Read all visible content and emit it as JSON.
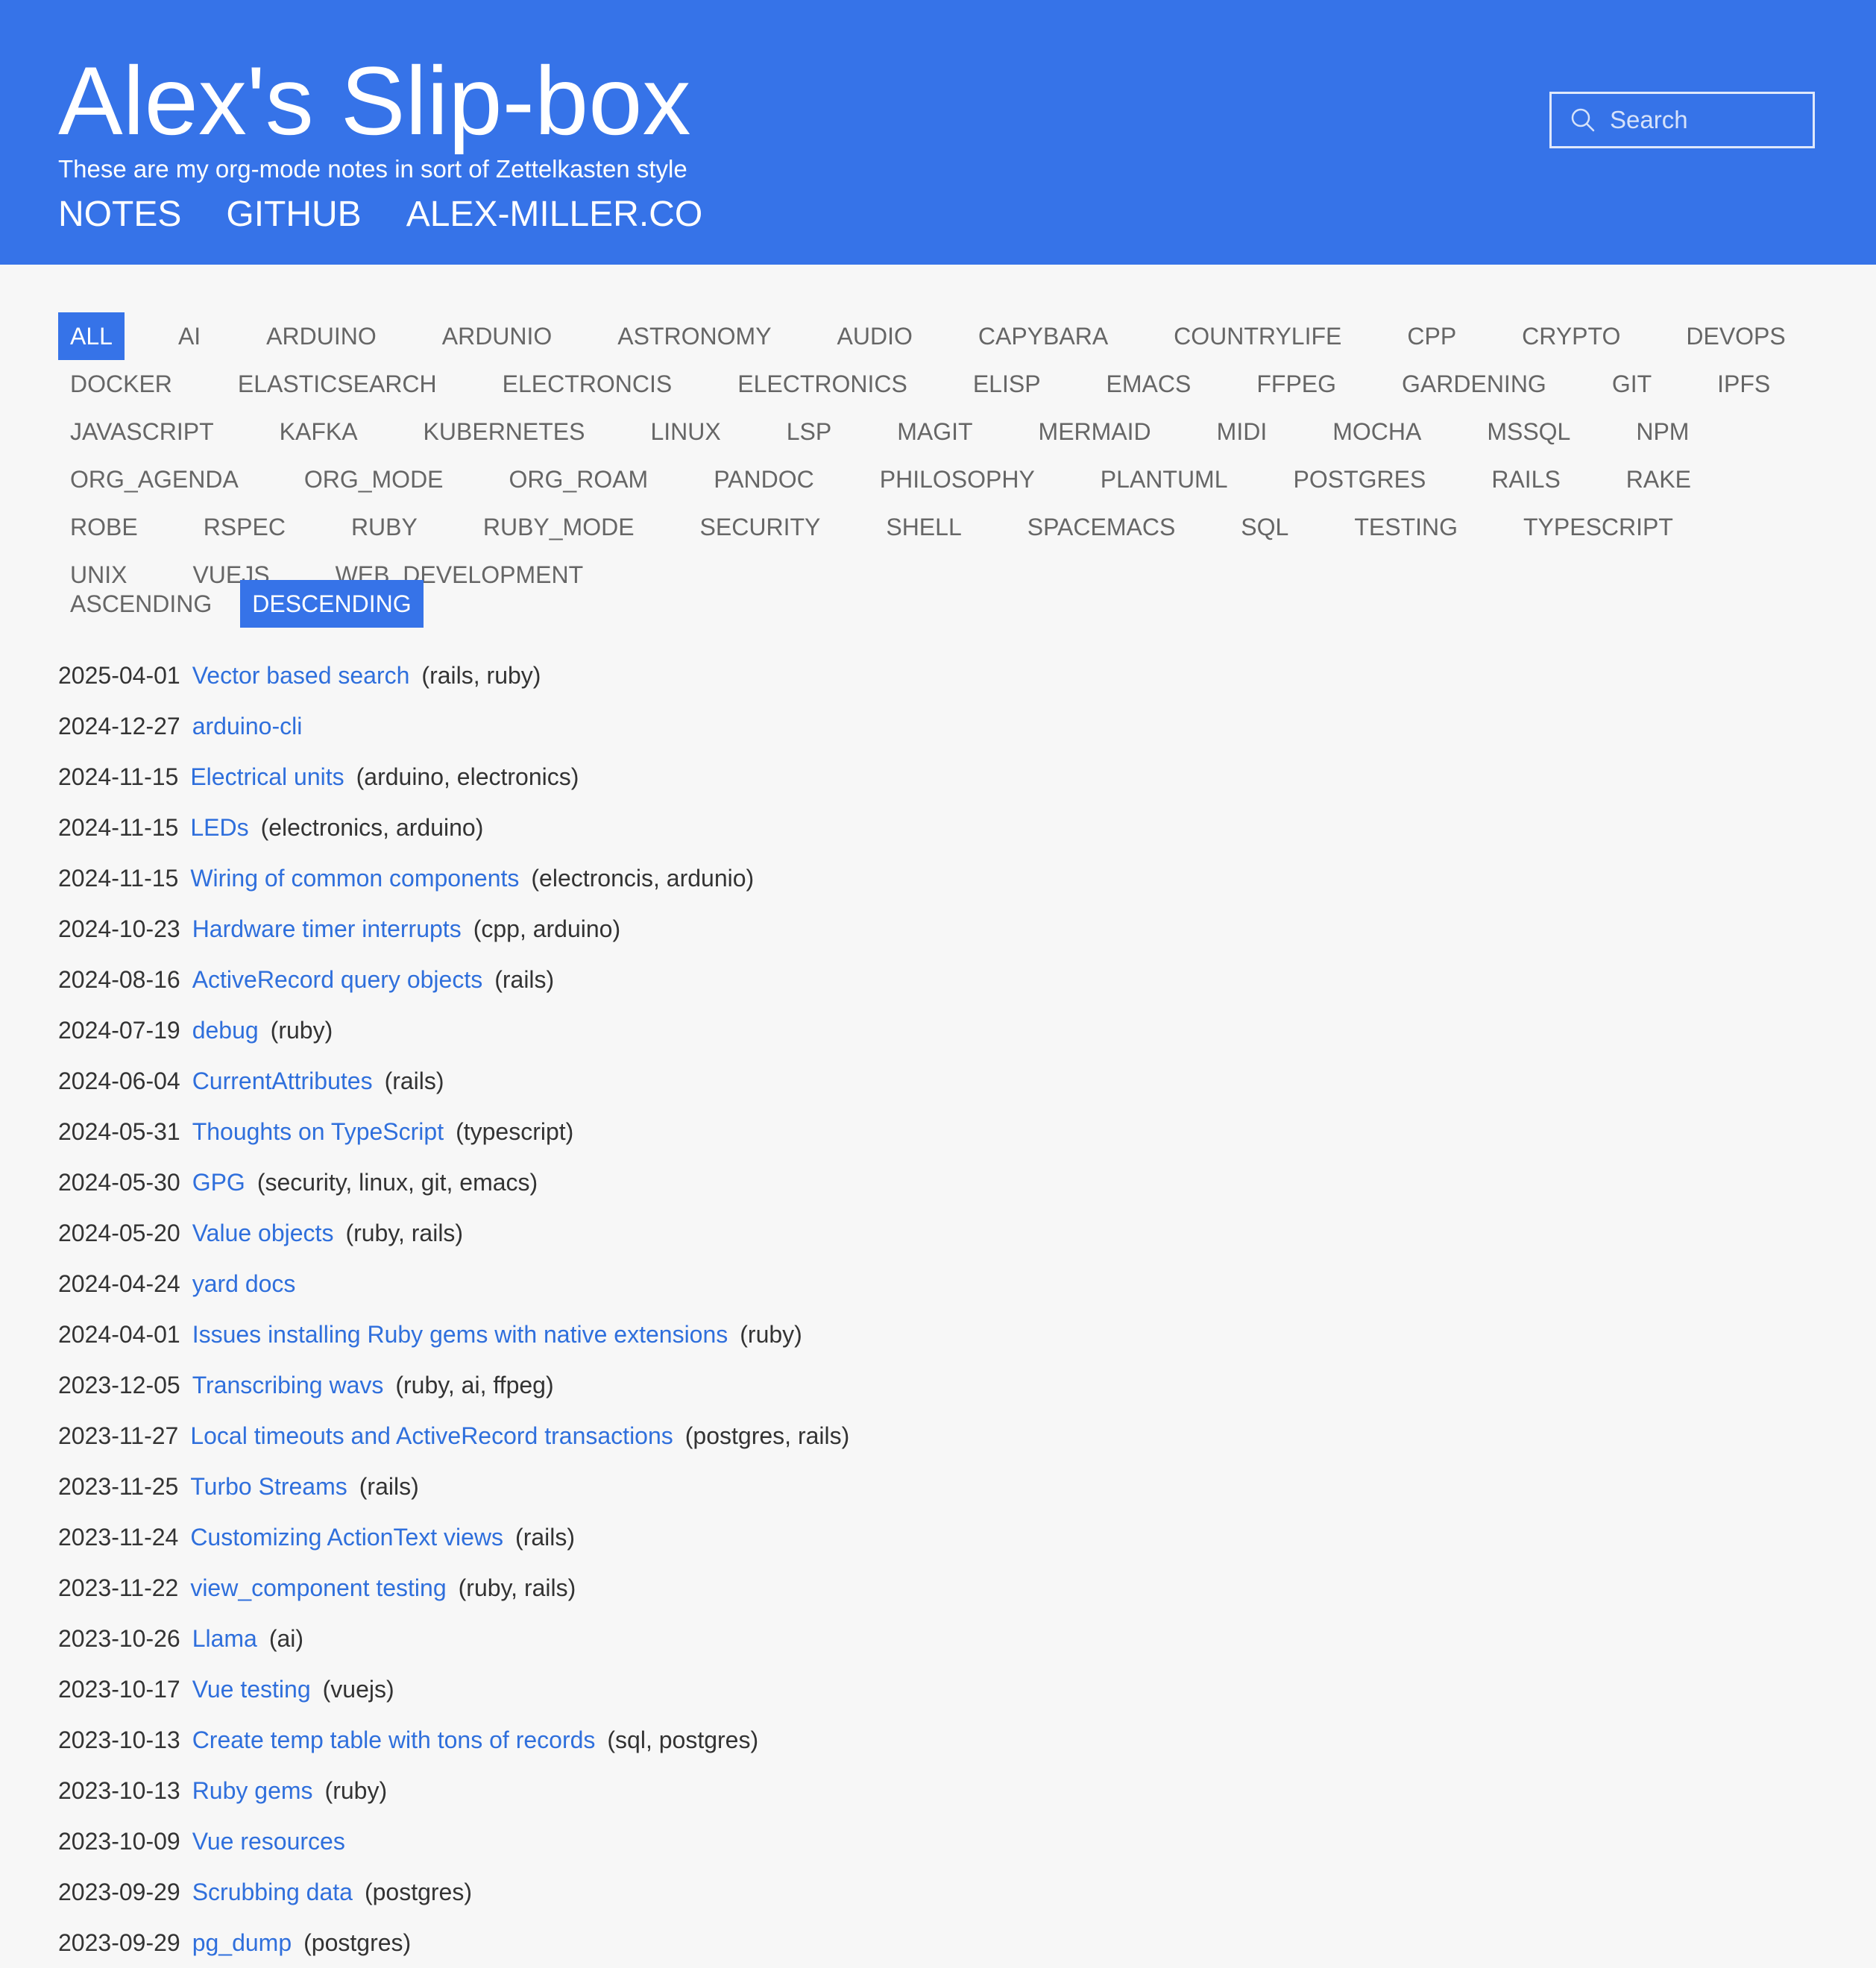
{
  "header": {
    "title": "Alex's Slip-box",
    "subtitle": "These are my org-mode notes in sort of Zettelkasten style",
    "nav": [
      "NOTES",
      "GITHUB",
      "ALEX-MILLER.CO"
    ]
  },
  "search": {
    "placeholder": "Search",
    "icon": "search-icon"
  },
  "tags": [
    "ALL",
    "AI",
    "ARDUINO",
    "ARDUNIO",
    "ASTRONOMY",
    "AUDIO",
    "CAPYBARA",
    "COUNTRYLIFE",
    "CPP",
    "CRYPTO",
    "DEVOPS",
    "DOCKER",
    "ELASTICSEARCH",
    "ELECTRONCIS",
    "ELECTRONICS",
    "ELISP",
    "EMACS",
    "FFPEG",
    "GARDENING",
    "GIT",
    "IPFS",
    "JAVASCRIPT",
    "KAFKA",
    "KUBERNETES",
    "LINUX",
    "LSP",
    "MAGIT",
    "MERMAID",
    "MIDI",
    "MOCHA",
    "MSSQL",
    "NPM",
    "ORG_AGENDA",
    "ORG_MODE",
    "ORG_ROAM",
    "PANDOC",
    "PHILOSOPHY",
    "PLANTUML",
    "POSTGRES",
    "RAILS",
    "RAKE",
    "ROBE",
    "RSPEC",
    "RUBY",
    "RUBY_MODE",
    "SECURITY",
    "SHELL",
    "SPACEMACS",
    "SQL",
    "TESTING",
    "TYPESCRIPT",
    "UNIX",
    "VUEJS",
    "WEB_DEVELOPMENT"
  ],
  "active_tag": "ALL",
  "sort": {
    "ascending": "ASCENDING",
    "descending": "DESCENDING",
    "active": "DESCENDING"
  },
  "notes": [
    {
      "date": "2025-04-01",
      "title": "Vector based search",
      "tags": "(rails, ruby)"
    },
    {
      "date": "2024-12-27",
      "title": "arduino-cli",
      "tags": ""
    },
    {
      "date": "2024-11-15",
      "title": "Electrical units",
      "tags": "(arduino, electronics)"
    },
    {
      "date": "2024-11-15",
      "title": "LEDs",
      "tags": "(electronics, arduino)"
    },
    {
      "date": "2024-11-15",
      "title": "Wiring of common components",
      "tags": "(electroncis, ardunio)"
    },
    {
      "date": "2024-10-23",
      "title": "Hardware timer interrupts",
      "tags": "(cpp, arduino)"
    },
    {
      "date": "2024-08-16",
      "title": "ActiveRecord query objects",
      "tags": "(rails)"
    },
    {
      "date": "2024-07-19",
      "title": "debug",
      "tags": "(ruby)"
    },
    {
      "date": "2024-06-04",
      "title": "CurrentAttributes",
      "tags": "(rails)"
    },
    {
      "date": "2024-05-31",
      "title": "Thoughts on TypeScript",
      "tags": "(typescript)"
    },
    {
      "date": "2024-05-30",
      "title": "GPG",
      "tags": "(security, linux, git, emacs)"
    },
    {
      "date": "2024-05-20",
      "title": "Value objects",
      "tags": "(ruby, rails)"
    },
    {
      "date": "2024-04-24",
      "title": "yard docs",
      "tags": ""
    },
    {
      "date": "2024-04-01",
      "title": "Issues installing Ruby gems with native extensions",
      "tags": "(ruby)"
    },
    {
      "date": "2023-12-05",
      "title": "Transcribing wavs",
      "tags": "(ruby, ai, ffpeg)"
    },
    {
      "date": "2023-11-27",
      "title": "Local timeouts and ActiveRecord transactions",
      "tags": "(postgres, rails)"
    },
    {
      "date": "2023-11-25",
      "title": "Turbo Streams",
      "tags": "(rails)"
    },
    {
      "date": "2023-11-24",
      "title": "Customizing ActionText views",
      "tags": "(rails)"
    },
    {
      "date": "2023-11-22",
      "title": "view_component testing",
      "tags": "(ruby, rails)"
    },
    {
      "date": "2023-10-26",
      "title": "Llama",
      "tags": "(ai)"
    },
    {
      "date": "2023-10-17",
      "title": "Vue testing",
      "tags": "(vuejs)"
    },
    {
      "date": "2023-10-13",
      "title": "Create temp table with tons of records",
      "tags": "(sql, postgres)"
    },
    {
      "date": "2023-10-13",
      "title": "Ruby gems",
      "tags": "(ruby)"
    },
    {
      "date": "2023-10-09",
      "title": "Vue resources",
      "tags": ""
    },
    {
      "date": "2023-09-29",
      "title": "Scrubbing data",
      "tags": "(postgres)"
    },
    {
      "date": "2023-09-29",
      "title": "pg_dump",
      "tags": "(postgres)"
    }
  ],
  "colors": {
    "accent": "#3673e8",
    "link": "#2f6fdc",
    "background": "#f7f7f7",
    "muted_text": "#666666"
  }
}
